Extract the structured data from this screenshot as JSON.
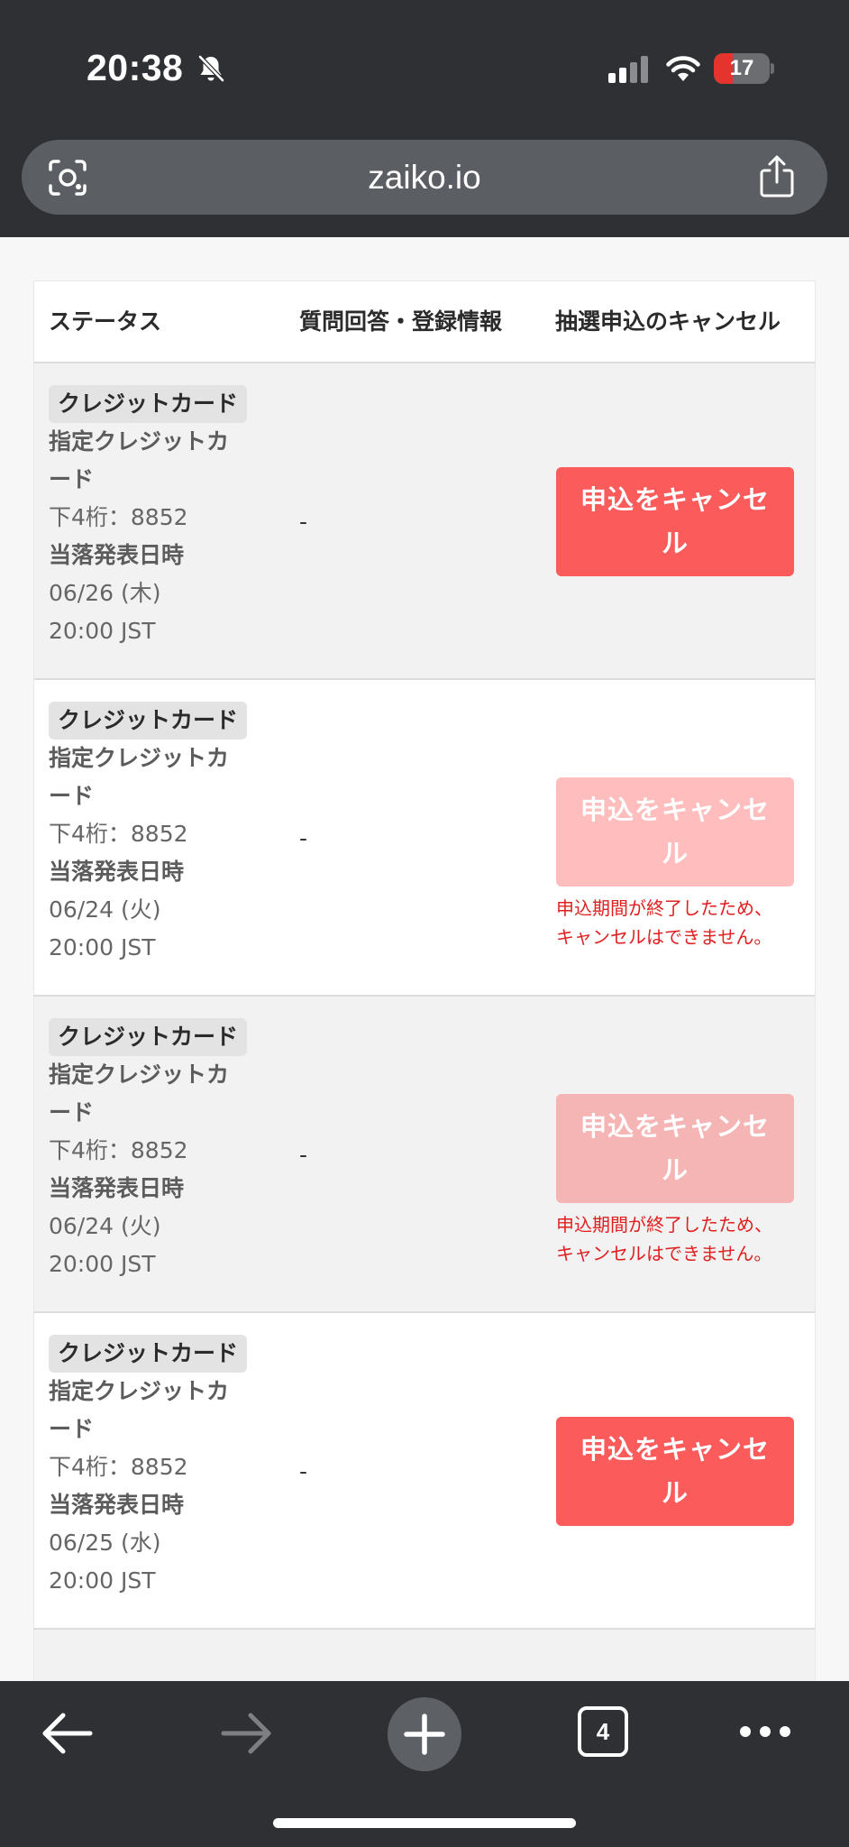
{
  "status_bar": {
    "time": "20:38",
    "battery_level": "17",
    "battery_fraction": 0.17
  },
  "browser": {
    "url": "zaiko.io",
    "tab_count": "4"
  },
  "table": {
    "headers": {
      "status": "ステータス",
      "question": "質問回答・登録情報",
      "cancel": "抽選申込のキャンセル"
    },
    "rows": [
      {
        "payment_badge": "クレジットカード",
        "card_label_1": "指定クレジットカ",
        "card_label_2": "ード",
        "last4": "下4桁：8852",
        "announce_label": "当落発表日時",
        "announce_date": "06/26 (木)",
        "announce_time": "20:00 JST",
        "answer": "-",
        "cancel_line1": "申込をキャンセ",
        "cancel_line2": "ル",
        "cancel_enabled": true,
        "note_line1": "",
        "note_line2": ""
      },
      {
        "payment_badge": "クレジットカード",
        "card_label_1": "指定クレジットカ",
        "card_label_2": "ード",
        "last4": "下4桁：8852",
        "announce_label": "当落発表日時",
        "announce_date": "06/24 (火)",
        "announce_time": "20:00 JST",
        "answer": "-",
        "cancel_line1": "申込をキャンセ",
        "cancel_line2": "ル",
        "cancel_enabled": false,
        "note_line1": "申込期間が終了したため、",
        "note_line2": "キャンセルはできません。"
      },
      {
        "payment_badge": "クレジットカード",
        "card_label_1": "指定クレジットカ",
        "card_label_2": "ード",
        "last4": "下4桁：8852",
        "announce_label": "当落発表日時",
        "announce_date": "06/24 (火)",
        "announce_time": "20:00 JST",
        "answer": "-",
        "cancel_line1": "申込をキャンセ",
        "cancel_line2": "ル",
        "cancel_enabled": false,
        "note_line1": "申込期間が終了したため、",
        "note_line2": "キャンセルはできません。"
      },
      {
        "payment_badge": "クレジットカード",
        "card_label_1": "指定クレジットカ",
        "card_label_2": "ード",
        "last4": "下4桁：8852",
        "announce_label": "当落発表日時",
        "announce_date": "06/25 (水)",
        "announce_time": "20:00 JST",
        "answer": "-",
        "cancel_line1": "申込をキャンセ",
        "cancel_line2": "ル",
        "cancel_enabled": true,
        "note_line1": "",
        "note_line2": ""
      }
    ]
  },
  "colors": {
    "cancel_active": "#fb5b5b",
    "cancel_disabled": "#ffbdbd",
    "note_red": "#e02020",
    "chrome_bg": "#2e3033"
  },
  "icons": {
    "bell": "bell-slash-icon",
    "signal": "cellular-signal-icon",
    "wifi": "wifi-icon",
    "lens": "camera-search-icon",
    "share": "share-icon",
    "back": "back-arrow-icon",
    "forward": "forward-arrow-icon",
    "new_tab": "plus-icon",
    "more": "more-dots-icon"
  }
}
